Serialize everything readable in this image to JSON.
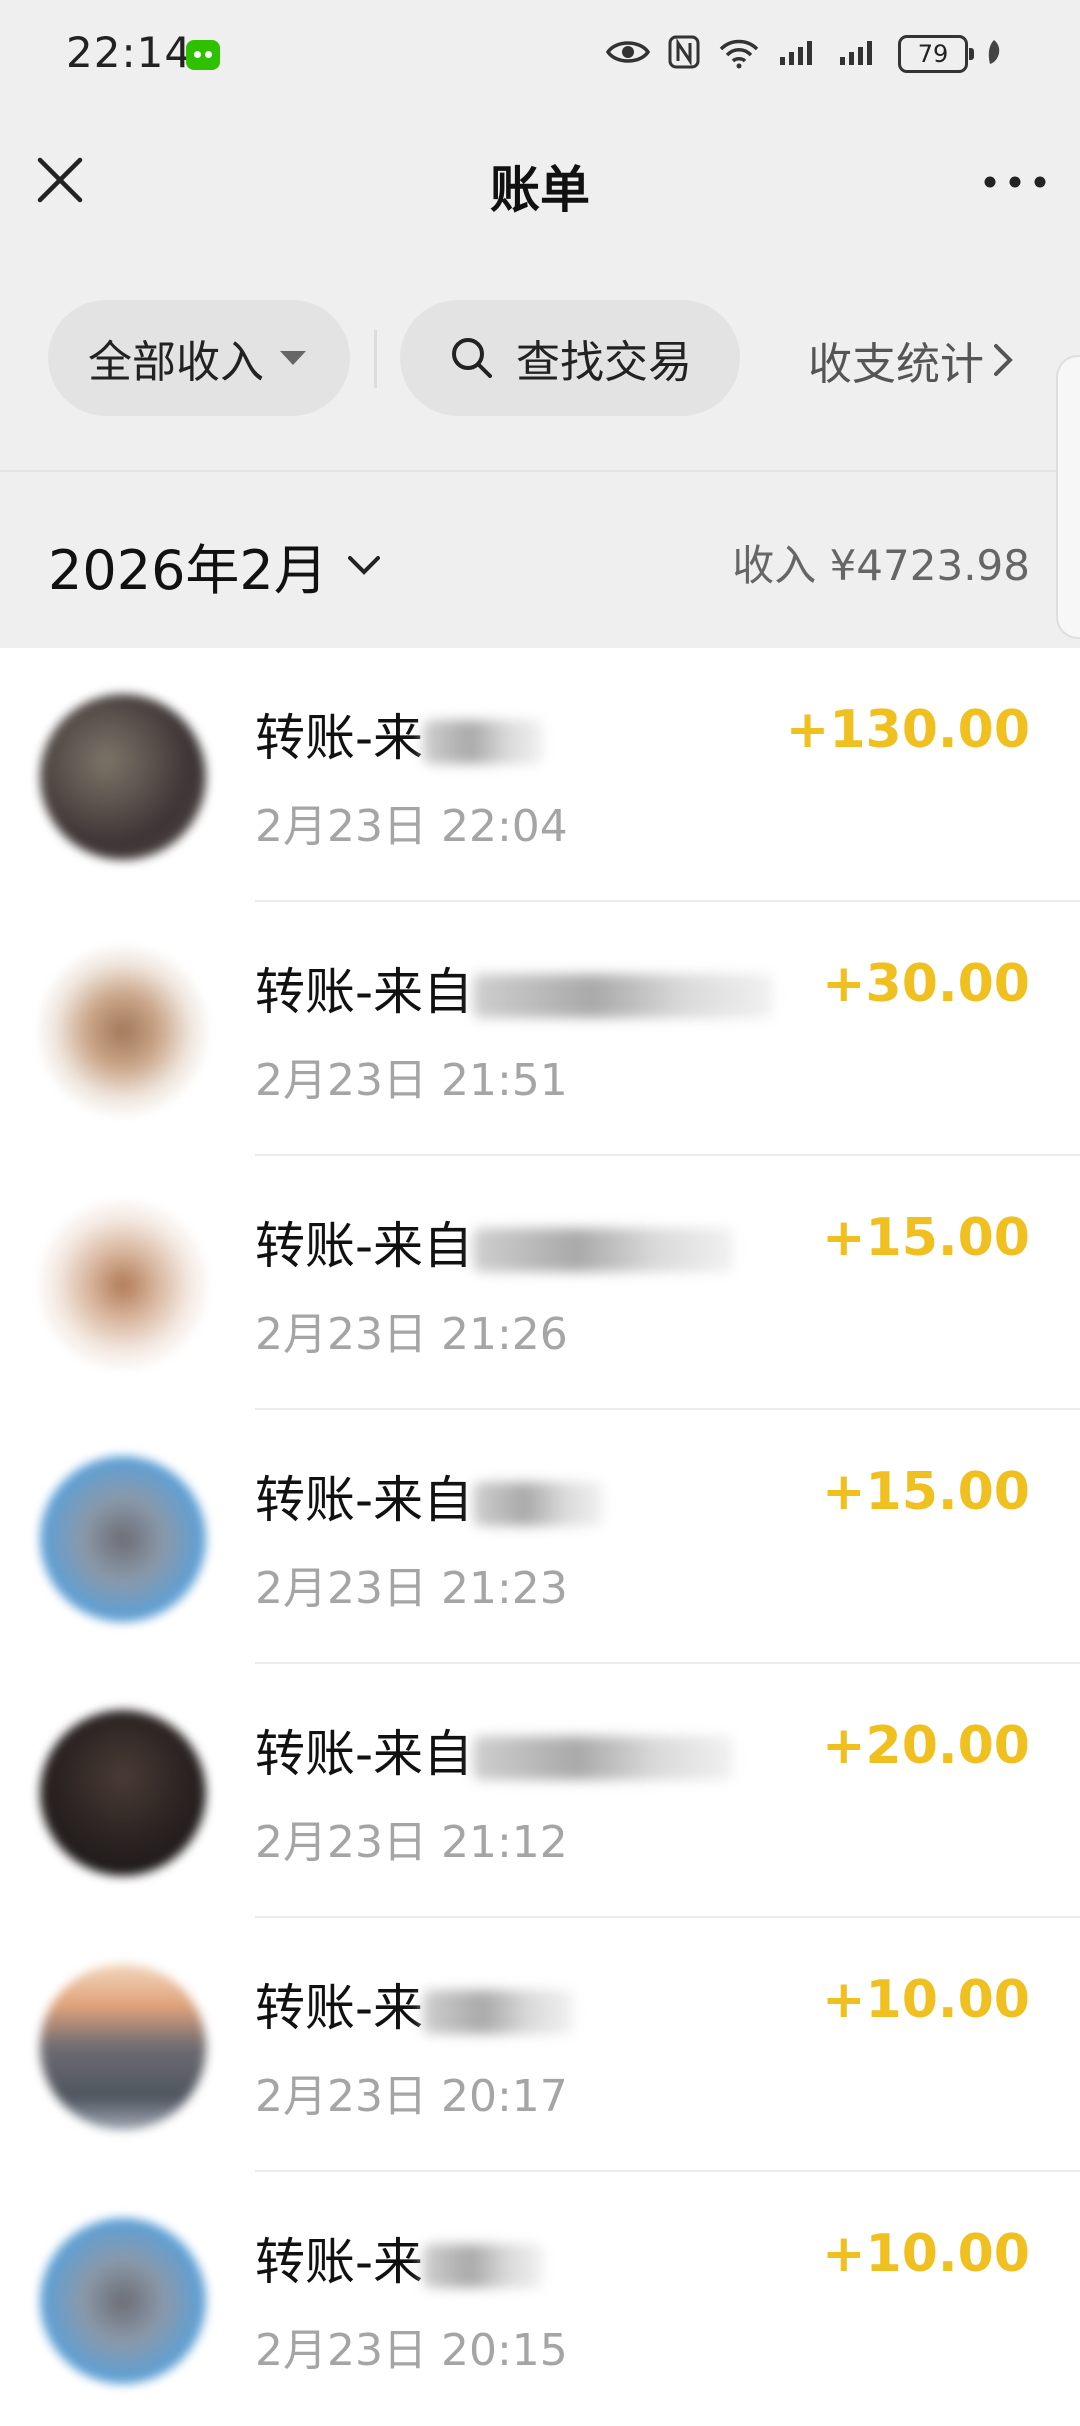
{
  "status_bar": {
    "time": "22:14",
    "battery": "79",
    "icons": [
      "wechat-icon",
      "eye-icon",
      "nfc-icon",
      "wifi-icon",
      "signal-icon",
      "signal-icon",
      "battery-icon",
      "leaf-icon"
    ]
  },
  "header": {
    "title": "账单",
    "close_icon": "close-icon",
    "more_icon": "more-icon"
  },
  "filters": {
    "income_filter": "全部收入",
    "search_label": "查找交易",
    "stats_link": "收支统计"
  },
  "summary": {
    "month": "2026年2月",
    "income": "收入 ¥4723.98"
  },
  "colors": {
    "amount": "#f0c020",
    "background_top": "#efefef",
    "pill": "#e3e3e3"
  },
  "transactions": [
    {
      "title": "转账-来",
      "time": "2月23日 22:04",
      "amount": "+130.00"
    },
    {
      "title": "转账-来自",
      "time": "2月23日 21:51",
      "amount": "+30.00"
    },
    {
      "title": "转账-来自",
      "time": "2月23日 21:26",
      "amount": "+15.00"
    },
    {
      "title": "转账-来自",
      "time": "2月23日 21:23",
      "amount": "+15.00"
    },
    {
      "title": "转账-来自",
      "time": "2月23日 21:12",
      "amount": "+20.00"
    },
    {
      "title": "转账-来",
      "time": "2月23日 20:17",
      "amount": "+10.00"
    },
    {
      "title": "转账-来",
      "time": "2月23日 20:15",
      "amount": "+10.00"
    }
  ]
}
